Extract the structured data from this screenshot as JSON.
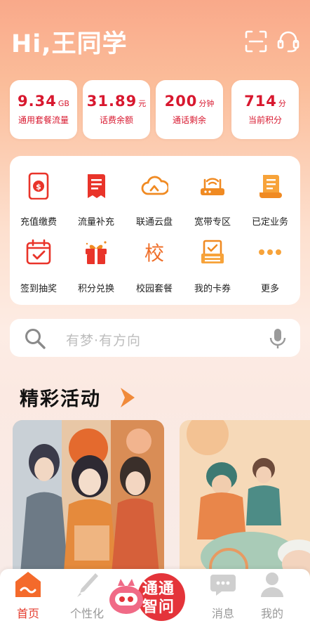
{
  "header": {
    "greeting": "Hi,王同学",
    "scan_icon": "scan-icon",
    "service_icon": "headset-icon"
  },
  "stats": [
    {
      "value": "9.34",
      "unit": "GB",
      "label": "通用套餐流量"
    },
    {
      "value": "31.89",
      "unit": "元",
      "label": "话费余额"
    },
    {
      "value": "200",
      "unit": "分钟",
      "label": "通话剩余"
    },
    {
      "value": "714",
      "unit": "分",
      "label": "当前积分"
    }
  ],
  "services": [
    {
      "label": "充值缴费",
      "icon": "phone-recharge-icon"
    },
    {
      "label": "流量补充",
      "icon": "document-icon"
    },
    {
      "label": "联通云盘",
      "icon": "cloud-home-icon"
    },
    {
      "label": "宽带专区",
      "icon": "router-icon"
    },
    {
      "label": "已定业务",
      "icon": "scroll-icon"
    },
    {
      "label": "签到抽奖",
      "icon": "calendar-check-icon"
    },
    {
      "label": "积分兑换",
      "icon": "gift-icon"
    },
    {
      "label": "校园套餐",
      "icon": "school-icon",
      "glyph": "校"
    },
    {
      "label": "我的卡券",
      "icon": "coupon-icon"
    },
    {
      "label": "更多",
      "icon": "more-dots-icon"
    }
  ],
  "search": {
    "placeholder": "有梦·有方向"
  },
  "activities": {
    "title": "精彩活动"
  },
  "tabbar": {
    "items": [
      {
        "label": "首页",
        "active": true
      },
      {
        "label": "个性化"
      },
      {
        "label": "消息"
      },
      {
        "label": "我的"
      }
    ],
    "center_line1": "通通",
    "center_line2": "智问"
  },
  "colors": {
    "accent": "#d8182f",
    "orange": "#ef6f2a",
    "active_tab": "#e53d2f"
  }
}
